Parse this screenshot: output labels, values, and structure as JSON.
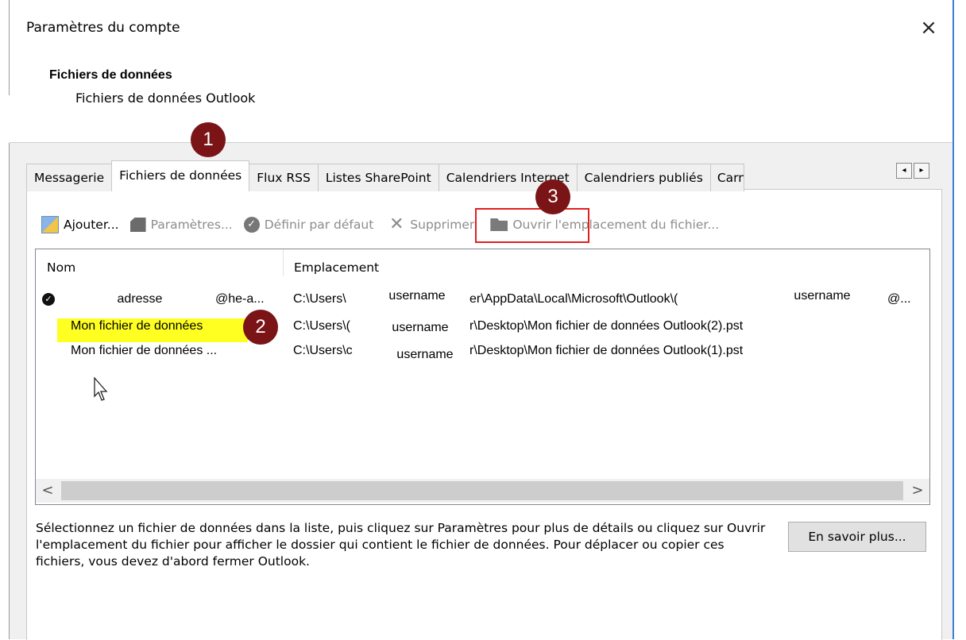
{
  "window": {
    "title": "Paramètres du compte",
    "close_icon": "×"
  },
  "header": {
    "title": "Fichiers de données",
    "subtitle": "Fichiers de données Outlook"
  },
  "tabs": [
    {
      "label": "Messagerie"
    },
    {
      "label": "Fichiers de données",
      "active": true
    },
    {
      "label": "Flux RSS"
    },
    {
      "label": "Listes SharePoint"
    },
    {
      "label": "Calendriers Internet"
    },
    {
      "label": "Calendriers publiés"
    },
    {
      "label": "Carnets d'adresses"
    }
  ],
  "tab_scroll": {
    "left": "◂",
    "right": "▸"
  },
  "toolbar": {
    "add": "Ajouter...",
    "settings": "Paramètres...",
    "set_default": "Définir par défaut",
    "remove": "Supprimer",
    "open_location": "Ouvrir l'emplacement du fichier..."
  },
  "list": {
    "columns": {
      "name": "Nom",
      "location": "Emplacement"
    },
    "rows": [
      {
        "default": true,
        "name_masked": "adresse",
        "name_suffix": "@he-a...",
        "loc_prefix": "C:\\Users\\",
        "loc_user": "username",
        "loc_rest": "er\\AppData\\Local\\Microsoft\\Outlook\\(",
        "loc_user2": "username",
        "loc_end": "@..."
      },
      {
        "name": "Mon fichier de données",
        "loc_prefix": "C:\\Users\\(",
        "loc_user": "username",
        "loc_rest": "r\\Desktop\\Mon fichier de données Outlook(2).pst"
      },
      {
        "name": "Mon fichier de données ...",
        "loc_prefix": "C:\\Users\\c",
        "loc_user": "username",
        "loc_rest": "r\\Desktop\\Mon fichier de données Outlook(1).pst"
      }
    ],
    "scroll_left": "<",
    "scroll_right": ">"
  },
  "badges": {
    "one": "1",
    "two": "2",
    "three": "3"
  },
  "footer": {
    "help_text": "Sélectionnez un fichier de données dans la liste, puis cliquez sur Paramètres pour plus de détails ou cliquez sur Ouvrir l'emplacement du fichier pour afficher le dossier qui contient le fichier de données. Pour déplacer ou copier ces fichiers, vous devez d'abord fermer Outlook.",
    "learn_more": "En savoir plus..."
  },
  "colors": {
    "badge": "#7a1416",
    "highlight": "#ffff22",
    "callout_box": "#e02020",
    "window_border": "#3c7fd6"
  }
}
